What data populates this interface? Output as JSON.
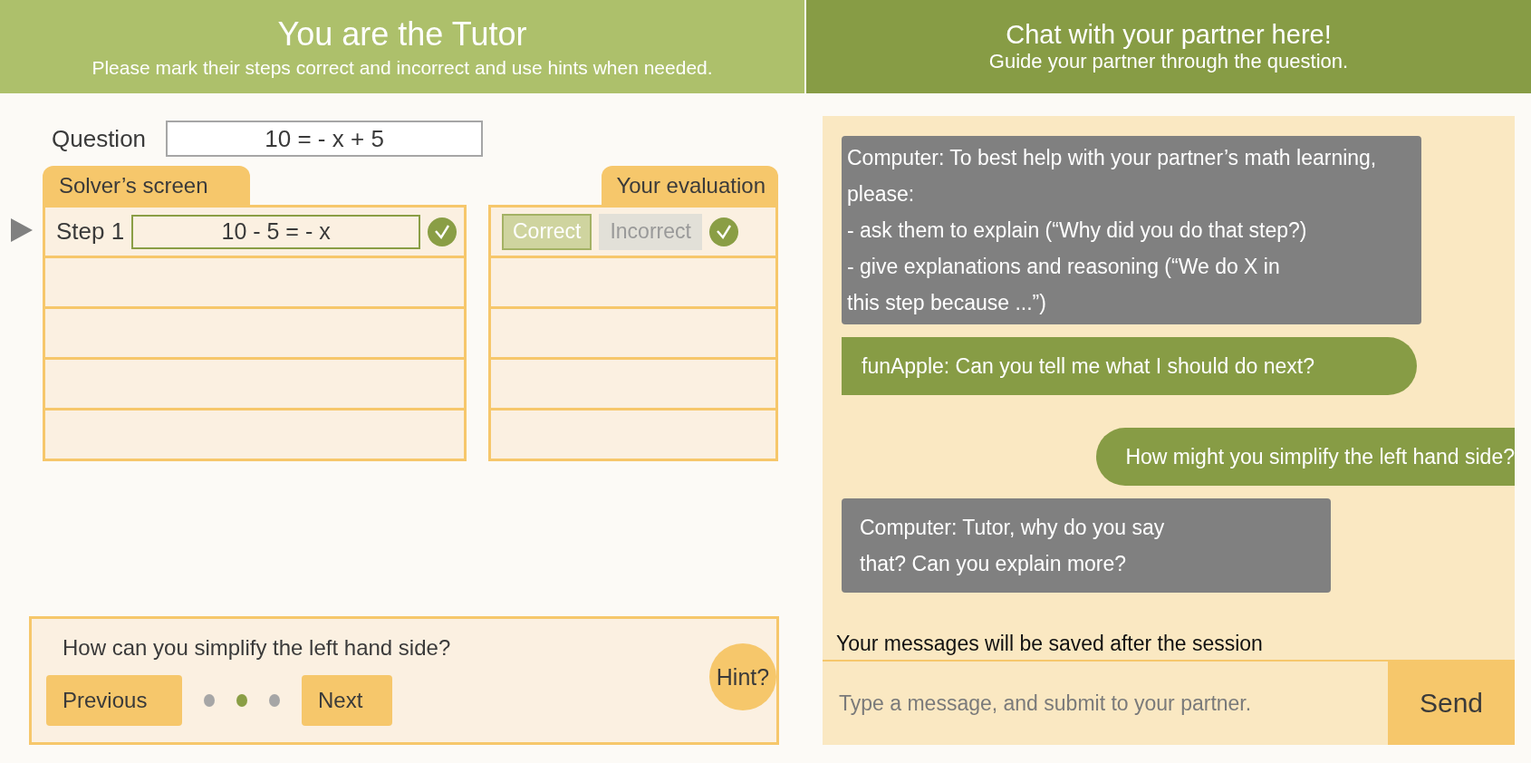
{
  "tutor_header": {
    "title": "You are the Tutor",
    "subtitle": "Please mark their steps correct and incorrect and use hints when needed."
  },
  "question": {
    "label": "Question",
    "value": "10 = - x + 5"
  },
  "solver_tab": "Solver’s screen",
  "evaluation_tab": "Your evaluation",
  "steps": [
    {
      "label": "Step 1",
      "value": "10 - 5 = - x",
      "current": true,
      "verified": true,
      "evaluation": [
        {
          "label": "Correct",
          "selected": true
        },
        {
          "label": "Incorrect",
          "selected": false
        }
      ],
      "evaluated": true
    }
  ],
  "hint": {
    "text": "How can you simplify the left hand side?",
    "previous": "Previous",
    "next": "Next",
    "hint_button": "Hint?",
    "pages": [
      {
        "selected": false
      },
      {
        "selected": true
      },
      {
        "selected": false
      }
    ]
  },
  "chat_header": {
    "title": "Chat with your partner here!",
    "subtitle": "Guide your partner through the question."
  },
  "messages": [
    {
      "kind": "computer",
      "text": "Computer: To best help with your partner’s math learning, please:\n- ask them to explain (“Why did you do that step?)\n- give explanations and reasoning (“We do X in\n this step because ...”)"
    },
    {
      "kind": "partner",
      "text": "funApple: Can you tell me what I should do next?"
    },
    {
      "kind": "self",
      "text": "How might you simplify the left hand side?"
    },
    {
      "kind": "computer",
      "text": "Computer: Tutor, why do you say\nthat? Can you explain more?"
    }
  ],
  "save_notice": "Your messages will be saved after the session",
  "message_input": {
    "placeholder": "Type a message, and submit to your partner."
  },
  "send_button": "Send"
}
